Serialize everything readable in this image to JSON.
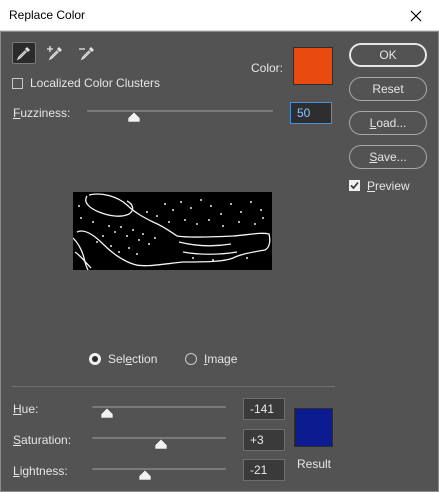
{
  "window": {
    "title": "Replace Color"
  },
  "tools": [
    "eyedropper-icon",
    "eyedropper-plus-icon",
    "eyedropper-minus-icon"
  ],
  "localized": {
    "label": "Localized Color Clusters",
    "checked": false
  },
  "color": {
    "label": "Color:",
    "swatch": "#e94a10"
  },
  "fuzziness": {
    "label_first": "F",
    "label_rest": "uzziness:",
    "value": "50",
    "level": 50,
    "max": 200
  },
  "preview_mode": {
    "selection_first": "Sel",
    "selection_u": "e",
    "selection_rest": "ction",
    "image_first": "I",
    "image_rest": "mage",
    "selected": "selection"
  },
  "buttons": {
    "ok": "OK",
    "reset": "Reset",
    "load_first": "L",
    "load_rest": "oad...",
    "save_first": "S",
    "save_rest": "ave..."
  },
  "preview": {
    "first": "P",
    "rest": "review",
    "checked": true
  },
  "hue": {
    "label_first": "H",
    "label_rest": "ue:",
    "value": "-141",
    "level": -141,
    "min": -180,
    "max": 180
  },
  "saturation": {
    "label_first": "S",
    "label_rest": "aturation:",
    "value": "+3",
    "level": 3,
    "min": -100,
    "max": 100
  },
  "lightness": {
    "label_first": "L",
    "label_rest": "ightness:",
    "value": "-21",
    "level": -21,
    "min": -100,
    "max": 100
  },
  "result": {
    "label": "Result",
    "swatch": "#0b1c91"
  }
}
